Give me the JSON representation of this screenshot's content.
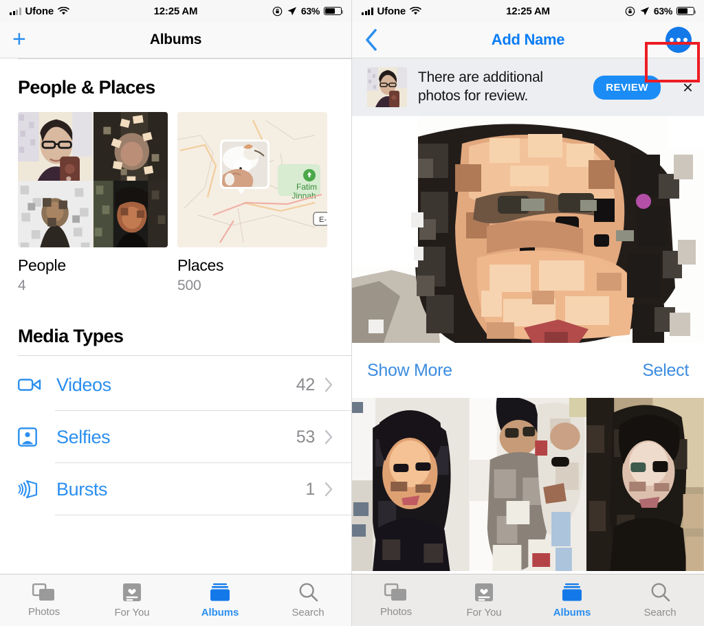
{
  "status_bar": {
    "carrier": "Ufone",
    "time": "12:25 AM",
    "battery_percent": "63%",
    "icons": [
      "signal-bars-icon",
      "wifi-icon",
      "rotation-lock-icon",
      "location-arrow-icon",
      "battery-icon"
    ]
  },
  "left_panel": {
    "nav": {
      "add_label": "+",
      "title": "Albums"
    },
    "people_places": {
      "heading": "People & Places",
      "cards": [
        {
          "label": "People",
          "count": "4",
          "thumb": "people-collage-thumbnail"
        },
        {
          "label": "Places",
          "count": "500",
          "thumb": "map-thumbnail",
          "map_label": "Fatima Jinnah",
          "map_marker_label": "E-"
        }
      ]
    },
    "media_types": {
      "heading": "Media Types",
      "rows": [
        {
          "label": "Videos",
          "count": "42",
          "icon": "video-camera-icon"
        },
        {
          "label": "Selfies",
          "count": "53",
          "icon": "person-portrait-icon"
        },
        {
          "label": "Bursts",
          "count": "1",
          "icon": "burst-stack-icon"
        }
      ]
    }
  },
  "right_panel": {
    "nav": {
      "back_icon": "chevron-left-icon",
      "title": "Add Name",
      "more_button": "more-options-icon"
    },
    "annotation": {
      "color": "#ed1c24",
      "target": "more-options-button"
    },
    "banner": {
      "message": "There are additional photos for review.",
      "action_label": "REVIEW",
      "close_label": "×",
      "thumb": "face-thumbnail"
    },
    "hero_photo": "pixelated-portrait-photo",
    "actions": {
      "show_more_label": "Show More",
      "select_label": "Select"
    },
    "photo_grid": [
      "pixelated-photo-1",
      "pixelated-photo-2",
      "pixelated-photo-3"
    ]
  },
  "tab_bar": {
    "tabs": [
      {
        "label": "Photos",
        "icon": "photos-stack-icon",
        "active": false
      },
      {
        "label": "For You",
        "icon": "for-you-card-icon",
        "active": false
      },
      {
        "label": "Albums",
        "icon": "albums-icon",
        "active": true
      },
      {
        "label": "Search",
        "icon": "search-icon",
        "active": false
      }
    ]
  },
  "colors": {
    "accent_blue": "#2b8fef",
    "link_blue": "#3c8ce0",
    "annotation_red": "#ed1c24",
    "muted_gray": "#8b8b8f"
  }
}
